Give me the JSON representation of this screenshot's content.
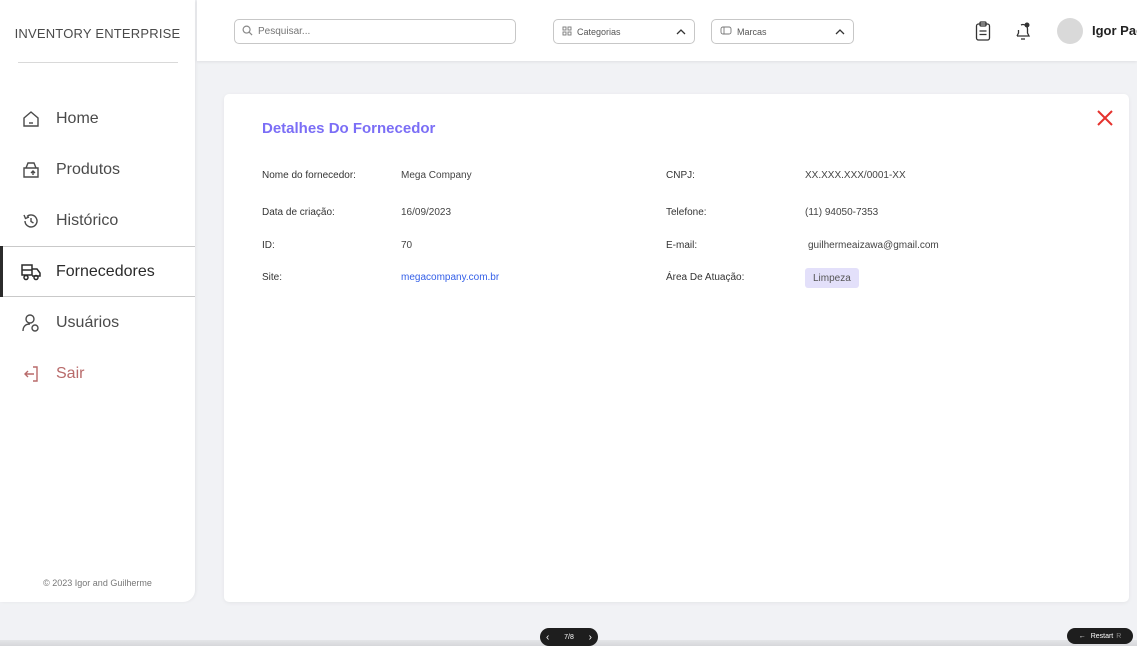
{
  "sidebar": {
    "brand": "INVENTORY ENTERPRISE",
    "items": [
      {
        "label": "Home",
        "icon": "home-icon"
      },
      {
        "label": "Produtos",
        "icon": "package-icon"
      },
      {
        "label": "Histórico",
        "icon": "history-icon"
      },
      {
        "label": "Fornecedores",
        "icon": "truck-icon",
        "active": true
      },
      {
        "label": "Usuários",
        "icon": "users-icon"
      },
      {
        "label": "Sair",
        "icon": "logout-icon"
      }
    ],
    "footer": "© 2023 Igor and Guilherme"
  },
  "header": {
    "search_placeholder": "Pesquisar...",
    "categories_label": "Categorias",
    "brands_label": "Marcas",
    "user_name": "Igor Pae"
  },
  "supplier": {
    "title": "Detalhes Do Fornecedor",
    "fields_left": [
      {
        "label": "Nome do fornecedor:",
        "value": "Mega Company"
      },
      {
        "label": "Data de criação:",
        "value": "16/09/2023"
      },
      {
        "label": "ID:",
        "value": "70"
      },
      {
        "label": "Site:",
        "value": "megacompany.com.br"
      }
    ],
    "fields_right": [
      {
        "label": "CNPJ:",
        "value": "XX.XXX.XXX/0001-XX"
      },
      {
        "label": "Telefone:",
        "value": "(11) 94050-7353"
      },
      {
        "label": "E-mail:",
        "value": "guilhermeaizawa@gmail.com"
      },
      {
        "label": "Área De Atuação:",
        "value": "Limpeza"
      }
    ]
  },
  "pager": {
    "text": "7/8"
  },
  "restart": {
    "label": "Restart",
    "key": "R"
  },
  "colors": {
    "accent": "#7b6ef6",
    "close": "#e5322d",
    "link": "#3560e8",
    "tag_bg": "#e3e0fa",
    "logout": "#b86a6a"
  }
}
